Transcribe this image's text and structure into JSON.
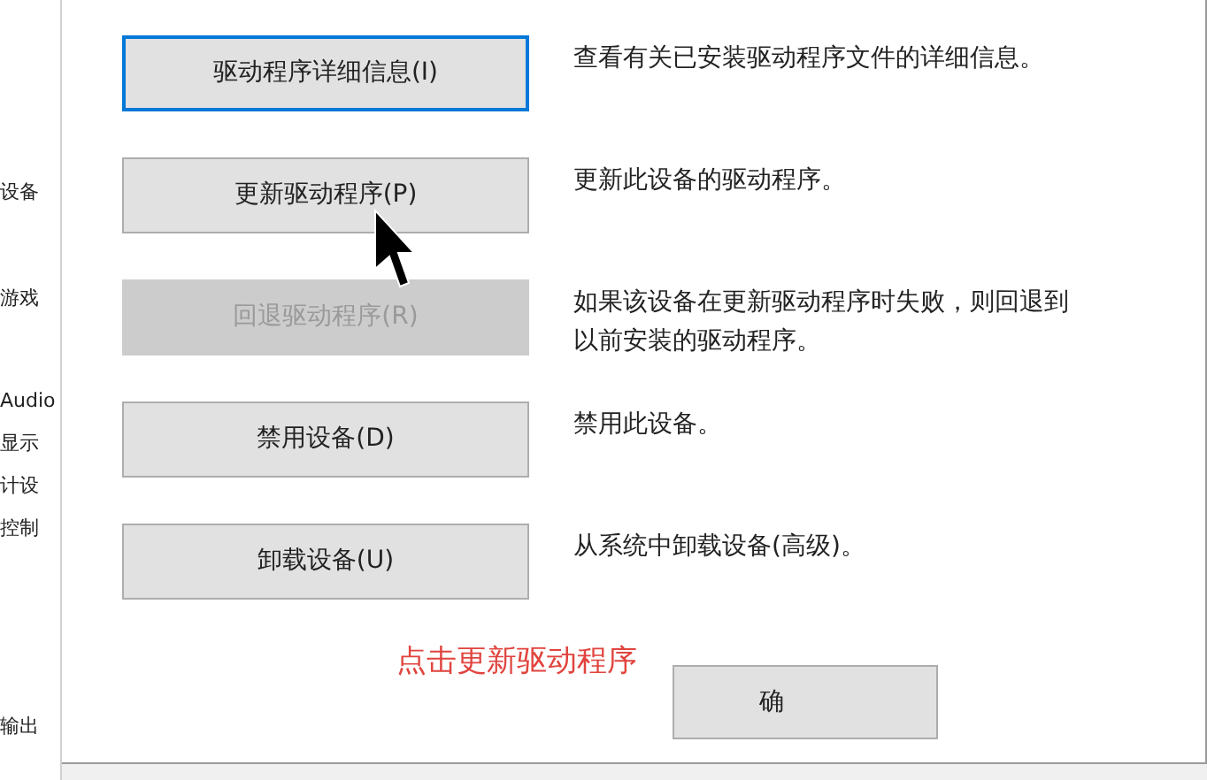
{
  "background_window": {
    "items": [
      "设备",
      "游戏",
      "Audio",
      "显示",
      "计设",
      "控制",
      "输出"
    ]
  },
  "actions": [
    {
      "label": "驱动程序详细信息(I)",
      "description": "查看有关已安装驱动程序文件的详细信息。",
      "focused": true,
      "disabled": false
    },
    {
      "label": "更新驱动程序(P)",
      "description": "更新此设备的驱动程序。",
      "focused": false,
      "disabled": false
    },
    {
      "label": "回退驱动程序(R)",
      "description": "如果该设备在更新驱动程序时失败，则回退到以前安装的驱动程序。",
      "focused": false,
      "disabled": true
    },
    {
      "label": "禁用设备(D)",
      "description": "禁用此设备。",
      "focused": false,
      "disabled": false
    },
    {
      "label": "卸载设备(U)",
      "description": "从系统中卸载设备(高级)。",
      "focused": false,
      "disabled": false
    }
  ],
  "annotation": "点击更新驱动程序",
  "ok_button": "确"
}
